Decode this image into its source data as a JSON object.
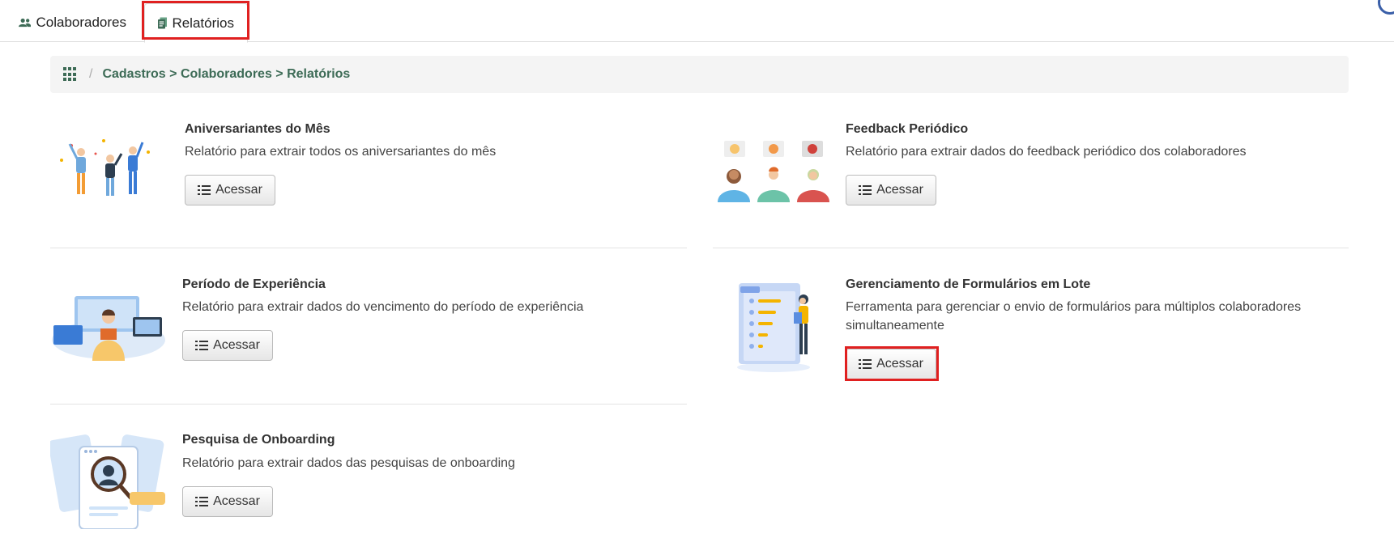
{
  "tabs": [
    {
      "label": "Colaboradores",
      "icon": "users-icon"
    },
    {
      "label": "Relatórios",
      "icon": "report-icon",
      "active": true
    }
  ],
  "breadcrumb": {
    "icon": "apps-grid-icon",
    "separator": "/",
    "path": "Cadastros > Colaboradores > Relatórios"
  },
  "reports": [
    {
      "title": "Aniversariantes do Mês",
      "description": "Relatório para extrair todos os aniversariantes do mês",
      "button": "Acessar"
    },
    {
      "title": "Feedback Periódico",
      "description": "Relatório para extrair dados do feedback periódico dos colaboradores",
      "button": "Acessar"
    },
    {
      "title": "Período de Experiência",
      "description": "Relatório para extrair dados do vencimento do período de experiência",
      "button": "Acessar"
    },
    {
      "title": "Gerenciamento de Formulários em Lote",
      "description": "Ferramenta para gerenciar o envio de formulários para múltiplos colaboradores simultaneamente",
      "button": "Acessar"
    },
    {
      "title": "Pesquisa de Onboarding",
      "description": "Relatório para extrair dados das pesquisas de onboarding",
      "button": "Acessar"
    }
  ],
  "colors": {
    "accent": "#3d6b56",
    "highlight": "#e02020"
  }
}
